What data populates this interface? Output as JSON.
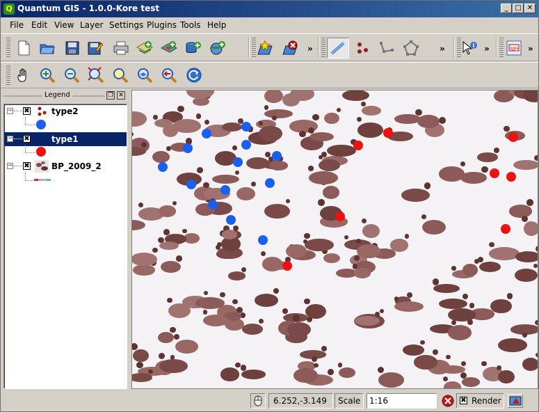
{
  "window": {
    "title": "Quantum GIS - 1.0.0-Kore  test",
    "app_icon_letter": "Q"
  },
  "menu": [
    "File",
    "Edit",
    "View",
    "Layer",
    "Settings",
    "Plugins",
    "Tools",
    "Help"
  ],
  "toolbar": {
    "row1_icons": [
      "new-project-icon",
      "open-project-icon",
      "save-project-icon",
      "save-as-icon",
      "print-icon",
      "add-vector-layer-icon",
      "add-raster-layer-icon",
      "add-postgis-layer-icon",
      "add-wms-layer-icon",
      "new-bookmark-icon",
      "remove-layer-icon",
      "capture-line-icon",
      "capture-point-icon",
      "capture-line-nodes-icon",
      "capture-polygon-icon",
      "identify-icon",
      "print-composer-icon"
    ],
    "row2_icons": [
      "pan-icon",
      "zoom-in-icon",
      "zoom-out-icon",
      "zoom-full-icon",
      "zoom-to-selection-icon",
      "zoom-to-layer-icon",
      "zoom-last-icon",
      "refresh-icon"
    ],
    "more_glyph": "»"
  },
  "legend": {
    "title": "Legend",
    "layers": [
      {
        "name": "type2",
        "expand": "−",
        "checked": "✖",
        "symbol_color": "#1a5ff0",
        "selected": false
      },
      {
        "name": "type1",
        "expand": "−",
        "checked": "✖",
        "symbol_color": "#ee1111",
        "selected": true
      },
      {
        "name": "BP_2009_2",
        "expand": "−",
        "checked": "✖",
        "symbol_color": null,
        "selected": false
      }
    ]
  },
  "map": {
    "background": "#f4f2f4",
    "type2_color": "#1a5ff0",
    "type1_color": "#ee1111",
    "type2_points": [
      [
        352,
        180
      ],
      [
        295,
        190
      ],
      [
        268,
        211
      ],
      [
        352,
        206
      ],
      [
        396,
        222
      ],
      [
        232,
        238
      ],
      [
        340,
        231
      ],
      [
        273,
        263
      ],
      [
        322,
        271
      ],
      [
        386,
        261
      ],
      [
        304,
        292
      ],
      [
        330,
        314
      ],
      [
        376,
        343
      ]
    ],
    "type1_points": [
      [
        556,
        189
      ],
      [
        513,
        207
      ],
      [
        736,
        195
      ],
      [
        709,
        247
      ],
      [
        733,
        252
      ],
      [
        487,
        309
      ],
      [
        725,
        327
      ],
      [
        411,
        380
      ]
    ]
  },
  "status": {
    "coordinates": "6.252,-3.149",
    "scale_label": "Scale",
    "scale_value": "1:16",
    "render_label": "Render",
    "render_checked": "✖"
  }
}
